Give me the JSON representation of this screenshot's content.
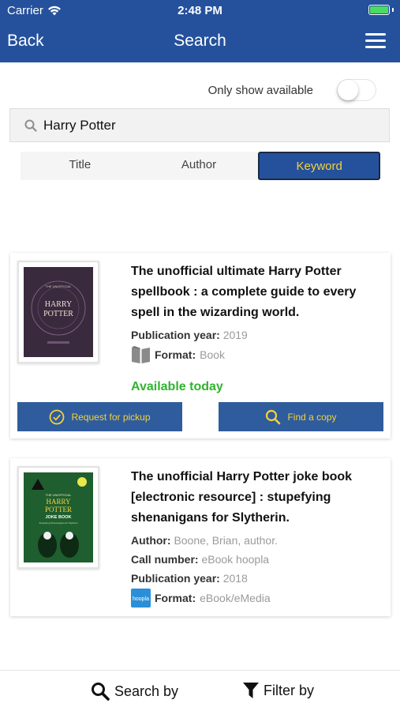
{
  "status_bar": {
    "carrier": "Carrier",
    "time": "2:48 PM"
  },
  "nav": {
    "back_label": "Back",
    "title": "Search"
  },
  "filter": {
    "only_available_label": "Only show available",
    "only_available_on": false
  },
  "search": {
    "query": "Harry Potter"
  },
  "segments": {
    "items": [
      "Title",
      "Author",
      "Keyword"
    ],
    "active": "Keyword"
  },
  "results": [
    {
      "title": "The unofficial ultimate Harry Potter spellbook : a complete guide to every spell in the wizarding world.",
      "pub_year_label": "Publication year:",
      "pub_year": "2019",
      "format_label": "Format:",
      "format": "Book",
      "availability": "Available today",
      "request_label": "Request for pickup",
      "find_label": "Find a copy",
      "cover": {
        "top": "THE UNOFFICIAL",
        "line1": "HARRY",
        "line2": "POTTER",
        "bg": "#3a2a3e"
      }
    },
    {
      "title": "The unofficial Harry Potter joke book [electronic resource] : stupefying shenanigans for Slytherin.",
      "author_label": "Author:",
      "author": "Boone, Brian, author.",
      "call_label": "Call number:",
      "call_number": "eBook hoopla",
      "pub_year_label": "Publication year:",
      "pub_year": "2018",
      "format_label": "Format:",
      "format": "eBook/eMedia",
      "format_badge": "hoopla",
      "cover": {
        "top": "THE UNOFFICIAL",
        "line1": "HARRY",
        "line2": "POTTER",
        "line3": "JOKE BOOK",
        "sub": "Stupefying Shenanigans for Slytherin",
        "bg": "#1f5e2e"
      }
    }
  ],
  "bottom_bar": {
    "search_by": "Search by",
    "filter_by": "Filter by"
  },
  "colors": {
    "brand": "#25519c",
    "accent": "#f3d23a",
    "available": "#2fb42f"
  }
}
